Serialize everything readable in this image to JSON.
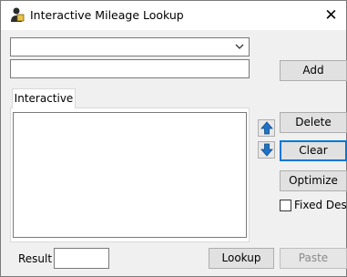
{
  "window": {
    "title": "Interactive Mileage Lookup",
    "close_glyph": "✕",
    "icon": "user-shield-icon"
  },
  "inputs": {
    "location_dropdown_value": "",
    "location_text_value": ""
  },
  "buttons": {
    "add": "Add",
    "delete": "Delete",
    "clear": "Clear",
    "optimize": "Optimize",
    "lookup": "Lookup",
    "paste": "Paste"
  },
  "tabs": {
    "interactive": "Interactive"
  },
  "list": {
    "items": []
  },
  "options": {
    "fixed_dest_label": "Fixed Dest.",
    "fixed_dest_checked": false
  },
  "result": {
    "label": "Result",
    "value": ""
  },
  "colors": {
    "focus_border": "#0078d7",
    "arrow_blue": "#1e73c8"
  }
}
